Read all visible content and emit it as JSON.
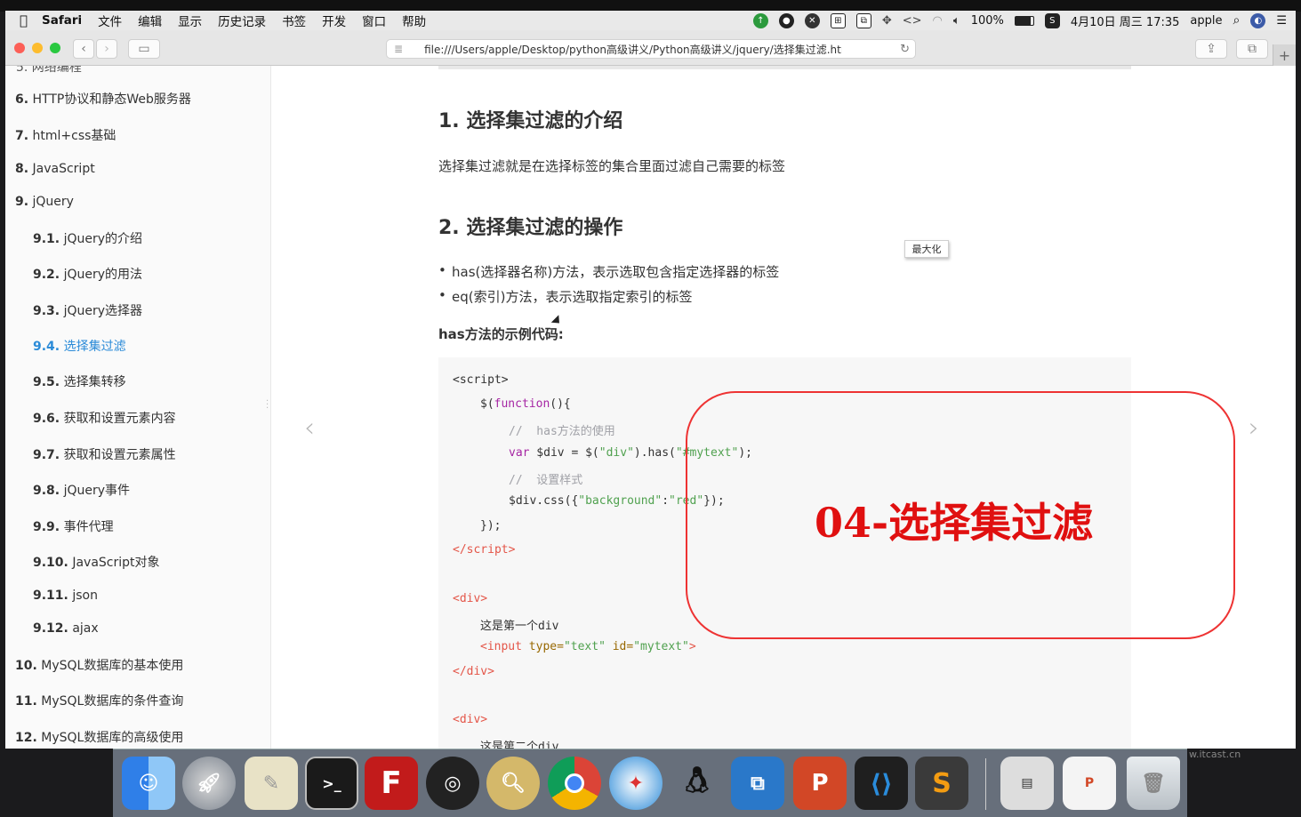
{
  "menubar": {
    "apple_icon": "apple-logo-icon",
    "app_name": "Safari",
    "items": [
      "文件",
      "编辑",
      "显示",
      "历史记录",
      "书签",
      "开发",
      "窗口",
      "帮助"
    ],
    "battery": "100%",
    "datetime": "4月10日 周三 17:35",
    "user": "apple"
  },
  "toolbar": {
    "url": "file:///Users/apple/Desktop/python高级讲义/Python高级讲义/jquery/选择集过滤.htm",
    "new_tab": "+"
  },
  "sidebar": {
    "items": [
      {
        "num": "6.",
        "label": "HTTP协议和静态Web服务器"
      },
      {
        "num": "7.",
        "label": "html+css基础"
      },
      {
        "num": "8.",
        "label": "JavaScript"
      },
      {
        "num": "9.",
        "label": "jQuery"
      },
      {
        "num": "9.1.",
        "label": "jQuery的介绍"
      },
      {
        "num": "9.2.",
        "label": "jQuery的用法"
      },
      {
        "num": "9.3.",
        "label": "jQuery选择器"
      },
      {
        "num": "9.4.",
        "label": "选择集过滤"
      },
      {
        "num": "9.5.",
        "label": "选择集转移"
      },
      {
        "num": "9.6.",
        "label": "获取和设置元素内容"
      },
      {
        "num": "9.7.",
        "label": "获取和设置元素属性"
      },
      {
        "num": "9.8.",
        "label": "jQuery事件"
      },
      {
        "num": "9.9.",
        "label": "事件代理"
      },
      {
        "num": "9.10.",
        "label": "JavaScript对象"
      },
      {
        "num": "9.11.",
        "label": "json"
      },
      {
        "num": "9.12.",
        "label": "ajax"
      },
      {
        "num": "10.",
        "label": "MySQL数据库的基本使用"
      },
      {
        "num": "11.",
        "label": "MySQL数据库的条件查询"
      },
      {
        "num": "12.",
        "label": "MySQL数据库的高级使用"
      }
    ]
  },
  "article": {
    "h1": "1. 选择集过滤的介绍",
    "intro": "选择集过滤就是在选择标签的集合里面过滤自己需要的标签",
    "h2": "2. 选择集过滤的操作",
    "bullet1": "has(选择器名称)方法，表示选取包含指定选择器的标签",
    "bullet2": "eq(索引)方法，表示选取指定索引的标签",
    "example_label": "has方法的示例代码:"
  },
  "tooltip": "最大化",
  "overlay_title": "04-选择集过滤",
  "watermark": "w.itcast.cn"
}
